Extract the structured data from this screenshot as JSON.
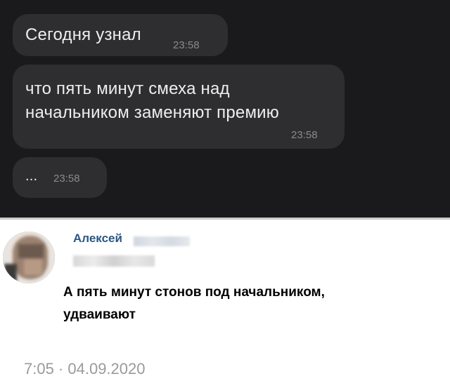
{
  "chat": {
    "messages": [
      {
        "text": "Сегодня узнал",
        "time": "23:58"
      },
      {
        "line1": "что пять минут смеха над",
        "line2": "начальником заменяют премию",
        "time": "23:58"
      },
      {
        "text": "...",
        "time": "23:58"
      }
    ]
  },
  "comment": {
    "author": "Алексей",
    "reply_line1": "А пять минут стонов под начальником,",
    "reply_line2": "удваивают",
    "timestamp": "7:05 · 04.09.2020"
  },
  "colors": {
    "dark_bg": "#1a1a1c",
    "bubble_bg": "#2e2e31",
    "author_link": "#2a5885"
  }
}
